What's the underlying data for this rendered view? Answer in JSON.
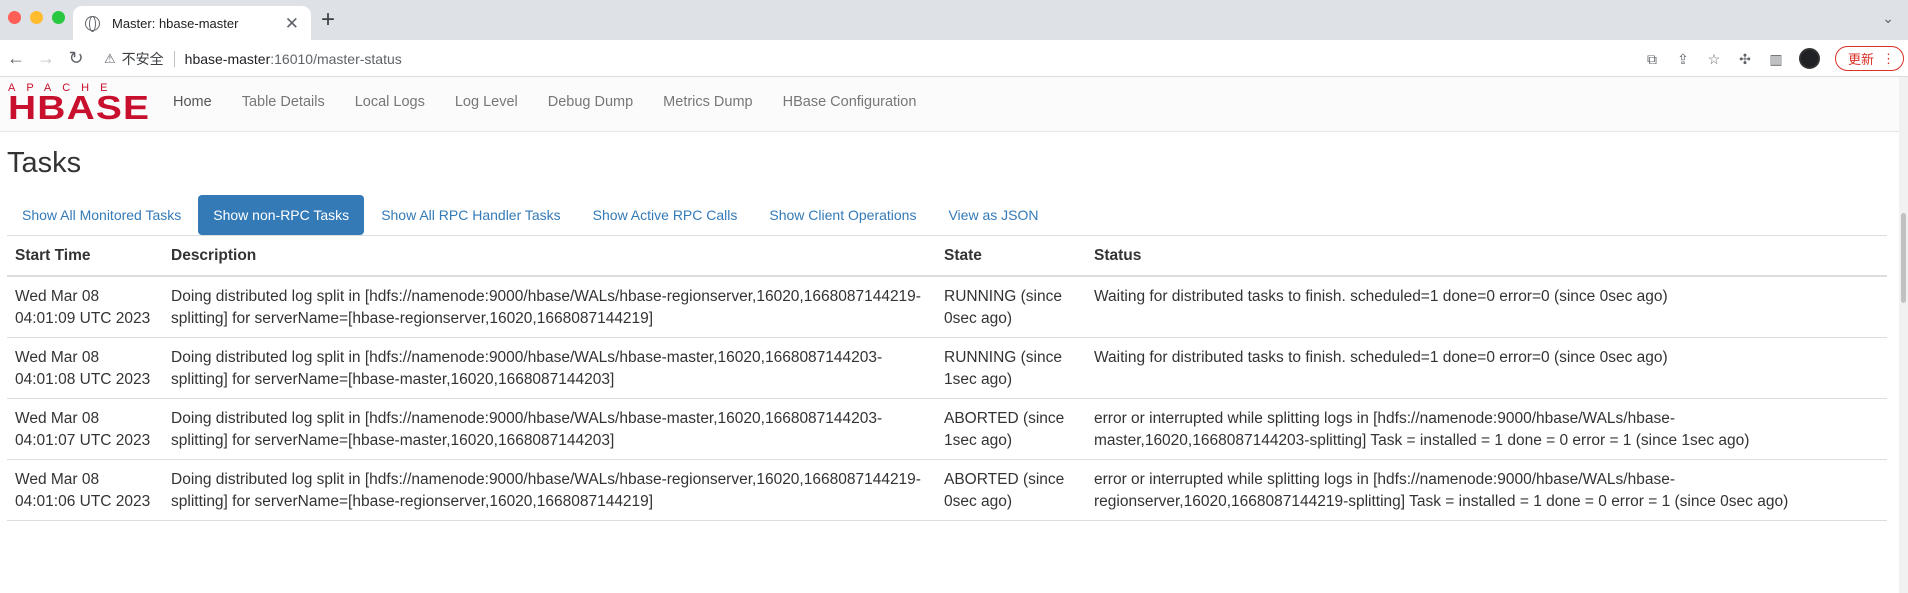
{
  "browser": {
    "tab_title": "Master: hbase-master",
    "new_tab_glyph": "+",
    "security_label": "不安全",
    "url_host": "hbase-master",
    "url_path": ":16010/master-status",
    "update_label": "更新"
  },
  "logo": {
    "top": "APACHE",
    "main": "HBASE"
  },
  "nav": {
    "items": [
      {
        "label": "Home"
      },
      {
        "label": "Table Details"
      },
      {
        "label": "Local Logs"
      },
      {
        "label": "Log Level"
      },
      {
        "label": "Debug Dump"
      },
      {
        "label": "Metrics Dump"
      },
      {
        "label": "HBase Configuration"
      }
    ]
  },
  "tasks": {
    "heading": "Tasks",
    "filters": [
      {
        "label": "Show All Monitored Tasks"
      },
      {
        "label": "Show non-RPC Tasks"
      },
      {
        "label": "Show All RPC Handler Tasks"
      },
      {
        "label": "Show Active RPC Calls"
      },
      {
        "label": "Show Client Operations"
      },
      {
        "label": "View as JSON"
      }
    ],
    "columns": [
      "Start Time",
      "Description",
      "State",
      "Status"
    ],
    "rows": [
      {
        "start": "Wed Mar 08 04:01:09 UTC 2023",
        "description": "Doing distributed log split in [hdfs://namenode:9000/hbase/WALs/hbase-regionserver,16020,1668087144219-splitting] for serverName=[hbase-regionserver,16020,1668087144219]",
        "state": "RUNNING (since 0sec ago)",
        "status": "Waiting for distributed tasks to finish. scheduled=1 done=0 error=0 (since 0sec ago)"
      },
      {
        "start": "Wed Mar 08 04:01:08 UTC 2023",
        "description": "Doing distributed log split in [hdfs://namenode:9000/hbase/WALs/hbase-master,16020,1668087144203-splitting] for serverName=[hbase-master,16020,1668087144203]",
        "state": "RUNNING (since 1sec ago)",
        "status": "Waiting for distributed tasks to finish. scheduled=1 done=0 error=0 (since 0sec ago)"
      },
      {
        "start": "Wed Mar 08 04:01:07 UTC 2023",
        "description": "Doing distributed log split in [hdfs://namenode:9000/hbase/WALs/hbase-master,16020,1668087144203-splitting] for serverName=[hbase-master,16020,1668087144203]",
        "state": "ABORTED (since 1sec ago)",
        "status": "error or interrupted while splitting logs in [hdfs://namenode:9000/hbase/WALs/hbase-master,16020,1668087144203-splitting] Task = installed = 1 done = 0 error = 1 (since 1sec ago)"
      },
      {
        "start": "Wed Mar 08 04:01:06 UTC 2023",
        "description": "Doing distributed log split in [hdfs://namenode:9000/hbase/WALs/hbase-regionserver,16020,1668087144219-splitting] for serverName=[hbase-regionserver,16020,1668087144219]",
        "state": "ABORTED (since 0sec ago)",
        "status": "error or interrupted while splitting logs in [hdfs://namenode:9000/hbase/WALs/hbase-regionserver,16020,1668087144219-splitting] Task = installed = 1 done = 0 error = 1 (since 0sec ago)"
      }
    ]
  }
}
